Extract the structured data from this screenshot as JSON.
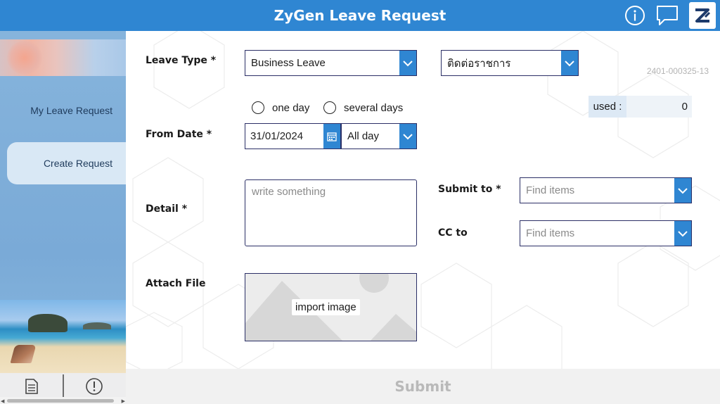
{
  "header": {
    "title": "ZyGen Leave Request",
    "info_icon": "info-icon",
    "chat_icon": "chat-icon",
    "logo_icon": "zygen-logo-icon"
  },
  "sidebar": {
    "items": [
      {
        "label": "My Leave Request"
      },
      {
        "label": "Create Request",
        "selected": true
      }
    ],
    "bottom_icons": [
      "document-icon",
      "alert-icon"
    ]
  },
  "form": {
    "reference": "2401-000325-13",
    "leave_type": {
      "label": "Leave Type *",
      "value": "Business Leave",
      "sub_value": "ติดต่อราชการ"
    },
    "duration": {
      "options": [
        "one day",
        "several days"
      ],
      "selected": null
    },
    "used": {
      "label": "used :",
      "value": "0"
    },
    "from_date": {
      "label": "From Date *",
      "value": "31/01/2024",
      "period": "All day"
    },
    "detail": {
      "label": "Detail *",
      "placeholder": "write something",
      "value": ""
    },
    "submit_to": {
      "label": "Submit to *",
      "placeholder": "Find items"
    },
    "cc_to": {
      "label": "CC to",
      "placeholder": "Find items"
    },
    "attach": {
      "label": "Attach File",
      "button_label": "import image"
    },
    "submit_label": "Submit"
  },
  "colors": {
    "header_bg": "#2f86d2",
    "accent": "#2f86d2",
    "border": "#2b2f66",
    "sidebar_bg": "#7aaad7",
    "selected_item_bg": "#d9e8f5",
    "submit_disabled_text": "#b9b9b9"
  }
}
